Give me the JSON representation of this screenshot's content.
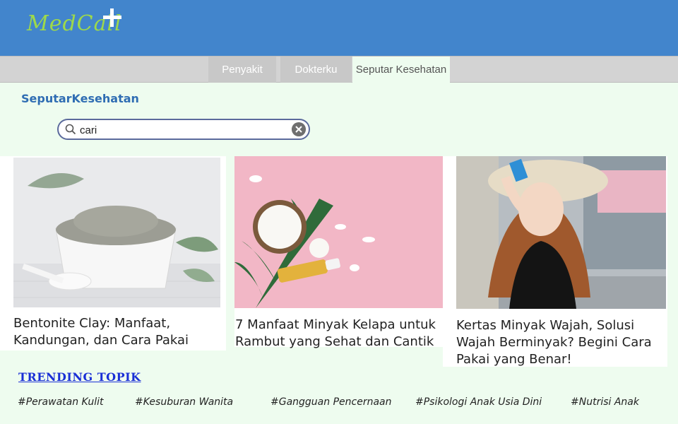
{
  "header": {
    "logo_text": "MedCall",
    "logo_icon": "plus-icon"
  },
  "nav": {
    "items": [
      {
        "label": "Penyakit"
      },
      {
        "label": "Dokterku"
      },
      {
        "label": "Seputar Kesehatan",
        "active": true
      }
    ]
  },
  "main": {
    "section_title": "SeputarKesehatan",
    "search": {
      "value": "cari",
      "placeholder": "cari",
      "icon": "search-icon",
      "clear_icon": "clear-icon"
    }
  },
  "articles": [
    {
      "title": "Bentonite Clay: Manfaat, Kandungan, dan Cara Pakai"
    },
    {
      "title": "7 Manfaat Minyak Kelapa untuk Rambut yang Sehat dan Cantik"
    },
    {
      "title": "Kertas Minyak Wajah, Solusi Wajah Berminyak? Begini Cara Pakai yang Benar!"
    }
  ],
  "trending": {
    "title": "TRENDING TOPIK",
    "tags": [
      "#Perawatan Kulit",
      "#Kesuburan Wanita",
      "#Gangguan Pencernaan",
      "#Psikologi Anak Usia Dini",
      "#Nutrisi Anak"
    ]
  },
  "colors": {
    "header_bg": "#4285cc",
    "logo": "#9ed94a",
    "page_bg": "#eefcef",
    "nav_bg": "#d3d3d3",
    "section_title": "#2f6db3",
    "trending_link": "#1a2fd6"
  }
}
